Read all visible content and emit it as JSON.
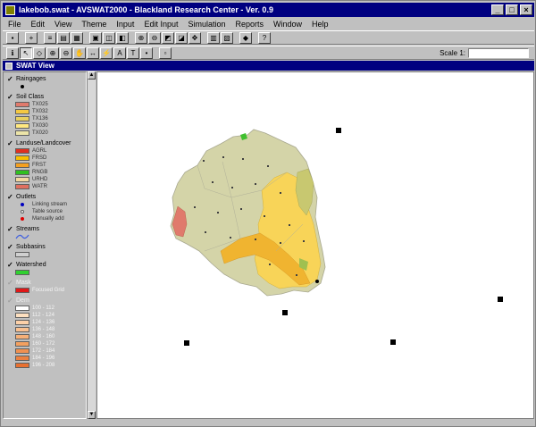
{
  "window": {
    "title": "lakebob.swat - AVSWAT2000 - Blackland Research Center - Ver. 0.9",
    "minimize": "_",
    "maximize": "□",
    "close": "×"
  },
  "menu": [
    "File",
    "Edit",
    "View",
    "Theme",
    "Input",
    "Edit Input",
    "Simulation",
    "Reports",
    "Window",
    "Help"
  ],
  "toolbar": {
    "scale_label": "Scale 1:",
    "scale_value": ""
  },
  "view": {
    "title": "SWAT View"
  },
  "legend": {
    "themes": [
      {
        "name": "Raingages",
        "checked": true,
        "kind": "point",
        "items": [
          {
            "color": "#000000",
            "label": ""
          }
        ]
      },
      {
        "name": "Soil Class",
        "checked": true,
        "kind": "poly",
        "items": [
          {
            "color": "#e07a6c",
            "label": "TX025"
          },
          {
            "color": "#f4c842",
            "label": "TX032"
          },
          {
            "color": "#e8d060",
            "label": "TX136"
          },
          {
            "color": "#ffe880",
            "label": "TX030"
          },
          {
            "color": "#ece4a8",
            "label": "TX020"
          }
        ]
      },
      {
        "name": "Landuse/Landcover",
        "checked": true,
        "kind": "poly",
        "items": [
          {
            "color": "#e03020",
            "label": "AGRL"
          },
          {
            "color": "#f8c000",
            "label": "FRSD"
          },
          {
            "color": "#f4a020",
            "label": "FRST"
          },
          {
            "color": "#30c020",
            "label": "RNGB"
          },
          {
            "color": "#f4d8a0",
            "label": "URHD"
          },
          {
            "color": "#e07060",
            "label": "WATR"
          }
        ]
      },
      {
        "name": "Outlets",
        "checked": true,
        "kind": "point",
        "items": [
          {
            "color": "#0000c0",
            "label": "Linking stream"
          },
          {
            "color": "#ffffff",
            "label": "Table source"
          },
          {
            "color": "#e00000",
            "label": "Manually add"
          }
        ]
      },
      {
        "name": "Streams",
        "checked": true,
        "kind": "line",
        "items": [
          {
            "color": "#4060e0",
            "label": ""
          }
        ]
      },
      {
        "name": "Subbasins",
        "checked": true,
        "kind": "poly",
        "items": [
          {
            "color": "#d0d0d0",
            "label": ""
          }
        ]
      },
      {
        "name": "Watershed",
        "checked": true,
        "kind": "poly",
        "items": [
          {
            "color": "#30d030",
            "label": ""
          }
        ]
      },
      {
        "name": "Mask",
        "checked": false,
        "kind": "poly",
        "items": [
          {
            "color": "#e01818",
            "label": "Focused Grid"
          }
        ]
      },
      {
        "name": "Dem",
        "checked": false,
        "kind": "poly",
        "items": [
          {
            "color": "#ffffff",
            "label": "100 - 112"
          },
          {
            "color": "#fde0c0",
            "label": "112 - 124"
          },
          {
            "color": "#fcd0a8",
            "label": "124 - 136"
          },
          {
            "color": "#f9c090",
            "label": "136 - 148"
          },
          {
            "color": "#f6b078",
            "label": "148 - 160"
          },
          {
            "color": "#f3a060",
            "label": "160 - 172"
          },
          {
            "color": "#f09050",
            "label": "172 - 184"
          },
          {
            "color": "#ec8040",
            "label": "184 - 196"
          },
          {
            "color": "#e87030",
            "label": "196 - 208"
          }
        ]
      }
    ]
  },
  "icons": {
    "toolbar_row1": [
      "save-icon",
      "add-theme-icon",
      "theme-properties-icon",
      "edit-legend-icon",
      "open-table-icon",
      "zoom-full-icon",
      "zoom-active-icon",
      "zoom-selected-icon",
      "zoom-in-icon",
      "zoom-out-icon",
      "select-features-icon",
      "clear-selection-icon",
      "help-icon"
    ],
    "toolbar_row2": [
      "identify-icon",
      "pointer-icon",
      "vertex-icon",
      "zoom-in-tool-icon",
      "zoom-out-tool-icon",
      "pan-icon",
      "measure-icon",
      "hotlink-icon",
      "label-icon",
      "text-icon",
      "draw-icon"
    ]
  }
}
